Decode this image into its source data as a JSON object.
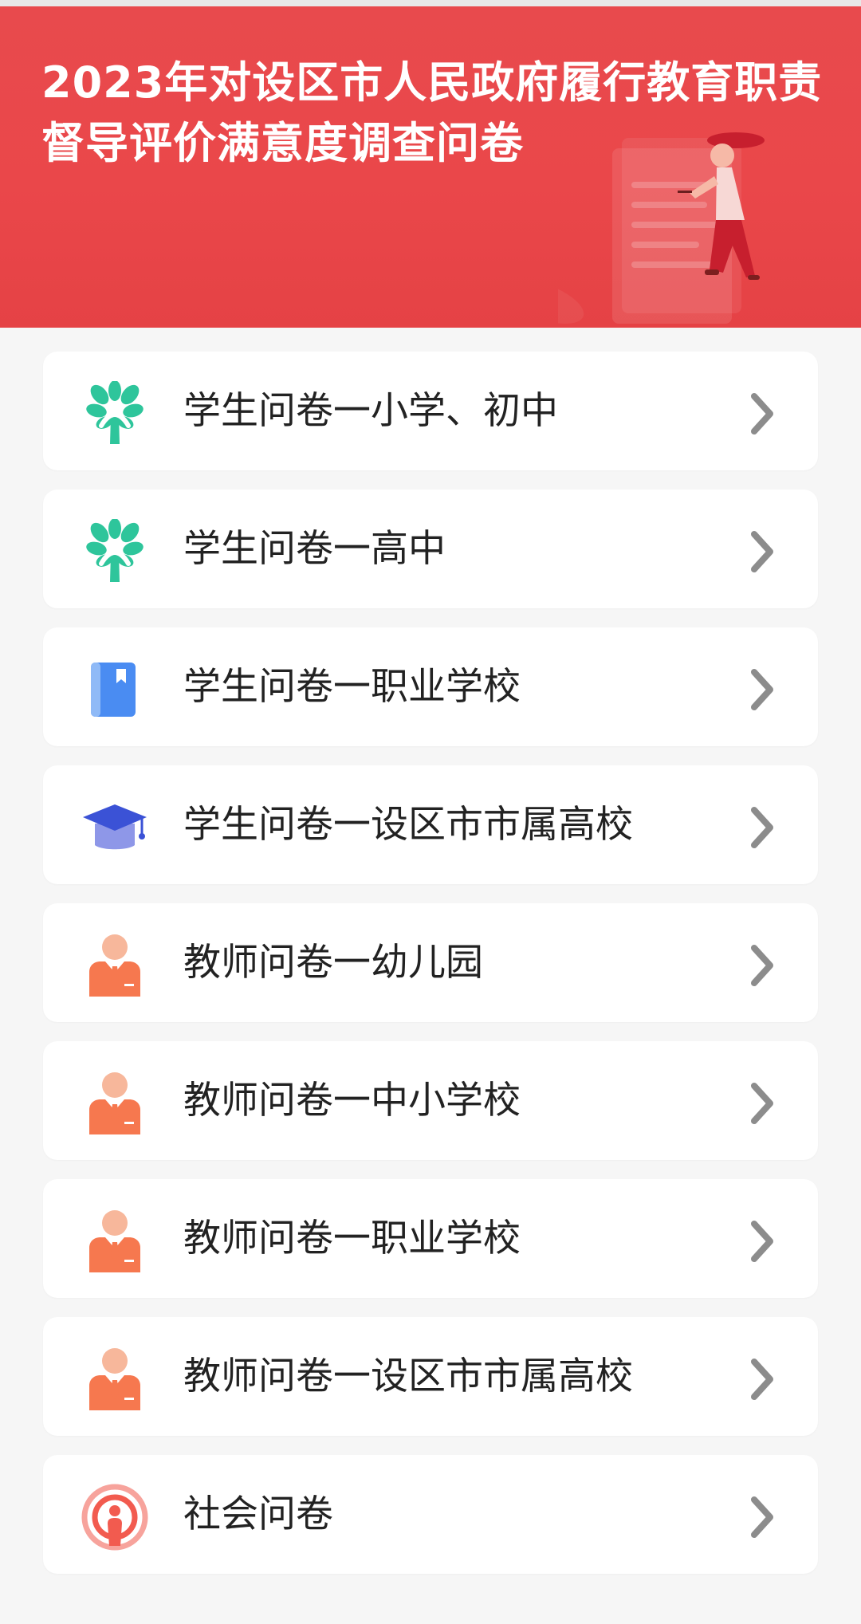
{
  "header": {
    "title": "2023年对设区市人民政府履行教育职责督导评价满意度调查问卷",
    "background_color": "#e84a4d"
  },
  "survey_list": {
    "items": [
      {
        "label": "学生问卷一小学、初中",
        "icon": "tree-icon"
      },
      {
        "label": "学生问卷一高中",
        "icon": "tree-icon"
      },
      {
        "label": "学生问卷一职业学校",
        "icon": "book-icon"
      },
      {
        "label": "学生问卷一设区市市属高校",
        "icon": "graduation-cap-icon"
      },
      {
        "label": "教师问卷一幼儿园",
        "icon": "teacher-icon"
      },
      {
        "label": "教师问卷一中小学校",
        "icon": "teacher-icon"
      },
      {
        "label": "教师问卷一职业学校",
        "icon": "teacher-icon"
      },
      {
        "label": "教师问卷一设区市市属高校",
        "icon": "teacher-icon"
      },
      {
        "label": "社会问卷",
        "icon": "broadcast-person-icon"
      }
    ]
  },
  "colors": {
    "tree": "#2ec59b",
    "book": "#4a8cf2",
    "cap": "#3b52d6",
    "teacher": "#f6784f",
    "broadcast": "#f25b4f",
    "chevron": "#8c8c8c"
  }
}
